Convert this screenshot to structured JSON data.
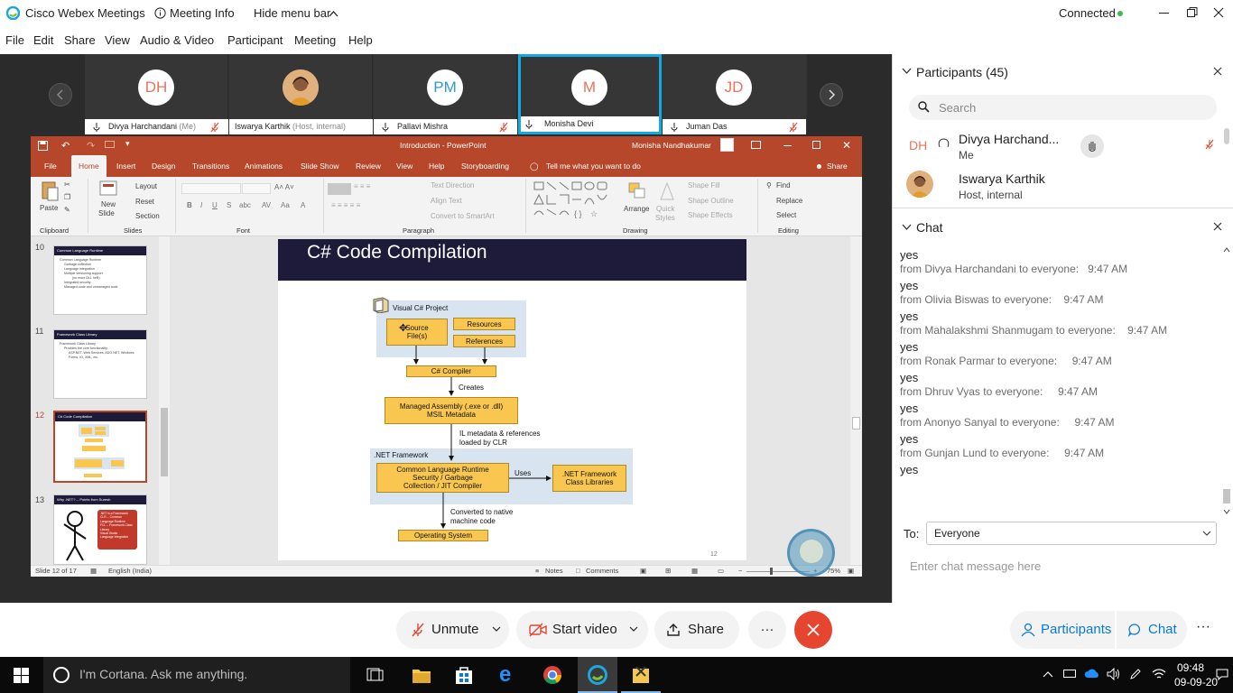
{
  "window": {
    "app_title": "Cisco Webex Meetings",
    "meeting_info": "Meeting Info",
    "hide_menu": "Hide menu bar",
    "status": "Connected"
  },
  "menu": [
    "File",
    "Edit",
    "Share",
    "View",
    "Audio & Video",
    "Participant",
    "Meeting",
    "Help"
  ],
  "video_strip": [
    {
      "initials": "DH",
      "name": "Divya Harchandani",
      "sub": " (Me)",
      "muted": true
    },
    {
      "initials": "",
      "name": "Iswarya Karthik",
      "sub": " (Host, internal)",
      "muted": false
    },
    {
      "initials": "PM",
      "name": "Pallavi Mishra",
      "sub": "",
      "muted": true
    },
    {
      "initials": "M",
      "name": "Monisha Devi",
      "sub": "",
      "muted": false,
      "active": true
    },
    {
      "initials": "JD",
      "name": "Juman Das",
      "sub": "",
      "muted": true
    }
  ],
  "ppt": {
    "doc_title": "Introduction - PowerPoint",
    "user": "Monisha Nandhakumar",
    "tabs": [
      "File",
      "Home",
      "Insert",
      "Design",
      "Transitions",
      "Animations",
      "Slide Show",
      "Review",
      "View",
      "Help",
      "Storyboarding"
    ],
    "tell_me": "Tell me what you want to do",
    "share": "Share",
    "ribbon": {
      "paste": "Paste",
      "new_slide_1": "New",
      "new_slide_2": "Slide",
      "layout": "Layout",
      "reset": "Reset",
      "section": "Section",
      "text_direction": "Text Direction",
      "align_text": "Align Text",
      "convert_smartart": "Convert to SmartArt",
      "arrange": "Arrange",
      "quick_styles_1": "Quick",
      "quick_styles_2": "Styles",
      "shape_fill": "Shape Fill",
      "shape_outline": "Shape Outline",
      "shape_effects": "Shape Effects",
      "find": "Find",
      "replace": "Replace",
      "select": "Select",
      "groups": [
        "Clipboard",
        "Slides",
        "Font",
        "Paragraph",
        "Drawing",
        "Editing"
      ]
    },
    "thumbnails": [
      {
        "num": "10",
        "title": "Common Language Runtime",
        "lines": [
          "Common Language Runtime",
          "Garbage collection",
          "Language integration",
          "Multiple versioning support",
          "(no more DLL hell!)",
          "Integrated security",
          "Managed code and unmanaged code"
        ]
      },
      {
        "num": "11",
        "title": "Framework Class Library",
        "lines": [
          "Framework Class Library",
          "Provides the core functionality:",
          "ASP.NET, Web Services, ADO.NET, Windows",
          "Forms, IO, XML, etc."
        ]
      },
      {
        "num": "12",
        "title": "C# Code Compilation",
        "lines": [],
        "selected": true
      },
      {
        "num": "13",
        "title": "Why .NET? -- Points from Suresh",
        "lines": [
          ".NET is a Framework",
          "CLR -- Common",
          "Language Runtime",
          "FCL -- Framework Class",
          "Library",
          "Visual Studio",
          "Language Integration"
        ]
      }
    ],
    "slide": {
      "title": "C# Code Compilation",
      "page_number": "12",
      "visual_project": "Visual C# Project",
      "source_files": "Source File(s)",
      "resources": "Resources",
      "references": "References",
      "compiler": "C# Compiler",
      "creates": "Creates",
      "assembly_1": "Managed Assembly (.exe or .dll)",
      "assembly_2": "MSIL Metadata",
      "il_note_1": "IL metadata & references",
      "il_note_2": "loaded by CLR",
      "net_framework": ".NET Framework",
      "clr_1": "Common Language Runtime",
      "clr_2": "Security / Garbage",
      "clr_3": "Collection / JIT Compiler",
      "uses": "Uses",
      "libs_1": ".NET Framework",
      "libs_2": "Class Libraries",
      "native_1": "Converted to native",
      "native_2": "machine code",
      "os": "Operating System"
    },
    "status": {
      "slide_of": "Slide 12 of 17",
      "language": "English (India)",
      "notes": "Notes",
      "comments": "Comments",
      "zoom": "75%"
    }
  },
  "participants_panel": {
    "title": "Participants (45)",
    "search_placeholder": "Search",
    "list": [
      {
        "initials": "DH",
        "name": "Divya Harchand...",
        "role": "Me"
      },
      {
        "initials": "",
        "name": "Iswarya Karthik",
        "role": "Host, internal"
      }
    ]
  },
  "chat_panel": {
    "title": "Chat",
    "messages": [
      {
        "text": "yes",
        "from": "from Divya Harchandani to everyone:",
        "time": "9:47 AM"
      },
      {
        "text": "yes",
        "from": "from Olivia Biswas to everyone:",
        "time": "9:47 AM"
      },
      {
        "text": "yes",
        "from": "from Mahalakshmi Shanmugam to everyone:",
        "time": "9:47 AM"
      },
      {
        "text": "yes",
        "from": "from Ronak Parmar to everyone:",
        "time": "9:47 AM"
      },
      {
        "text": "yes",
        "from": "from Dhruv Vyas to everyone:",
        "time": "9:47 AM"
      },
      {
        "text": "yes",
        "from": "from Anonyo Sanyal to everyone:",
        "time": "9:47 AM"
      },
      {
        "text": "yes",
        "from": "from Gunjan Lund to everyone:",
        "time": "9:47 AM"
      },
      {
        "text": "yes",
        "from": "",
        "time": ""
      }
    ],
    "to_label": "To:",
    "to_value": "Everyone",
    "input_placeholder": "Enter chat message here"
  },
  "controls": {
    "unmute": "Unmute",
    "start_video": "Start video",
    "share": "Share",
    "participants": "Participants",
    "chat": "Chat"
  },
  "taskbar": {
    "cortana": "I'm Cortana. Ask me anything.",
    "time": "09:48",
    "date": "09-09-20"
  },
  "colors": {
    "accent_red": "#e6452f",
    "webex_blue": "#0a7ad6",
    "ppt_brand": "#b7472a",
    "connected_green": "#3fb950"
  }
}
